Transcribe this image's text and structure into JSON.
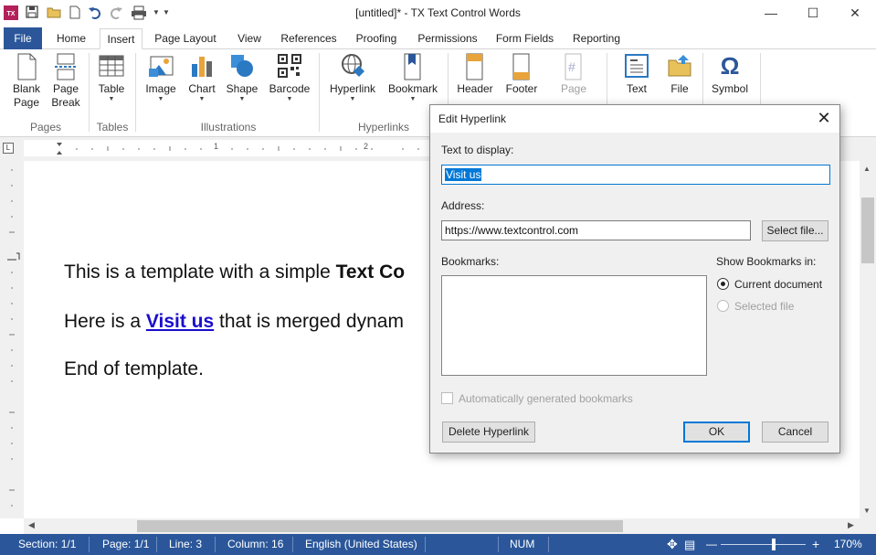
{
  "window": {
    "title": "[untitled]* - TX Text Control Words",
    "app_icon": "TX",
    "minimize_label": "—",
    "maximize_label": "☐",
    "close_label": "✕"
  },
  "quick_access": {
    "icons": [
      "save-icon",
      "open-folder-icon",
      "new-document-icon",
      "undo-icon",
      "redo-icon",
      "print-icon",
      "customize-dropdown-icon"
    ]
  },
  "tabs": [
    {
      "label": "File"
    },
    {
      "label": "Home"
    },
    {
      "label": "Insert"
    },
    {
      "label": "Page Layout"
    },
    {
      "label": "View"
    },
    {
      "label": "References"
    },
    {
      "label": "Proofing"
    },
    {
      "label": "Permissions"
    },
    {
      "label": "Form Fields"
    },
    {
      "label": "Reporting"
    }
  ],
  "ribbon": {
    "buttons": {
      "blank_page": "Blank\nPage",
      "page_break": "Page\nBreak",
      "table": "Table",
      "image": "Image",
      "chart": "Chart",
      "shape": "Shape",
      "barcode": "Barcode",
      "hyperlink": "Hyperlink",
      "bookmark": "Bookmark",
      "header": "Header",
      "footer": "Footer",
      "page_number": "Page",
      "text": "Text",
      "file": "File",
      "symbol": "Symbol"
    },
    "groups": {
      "pages": "Pages",
      "tables": "Tables",
      "illustrations": "Illustrations",
      "hyperlinks": "Hyperlinks"
    },
    "symbol_glyph": "Ω",
    "page_number_glyph": "#"
  },
  "ruler": {
    "corner": "L",
    "marks": [
      "1",
      "2"
    ]
  },
  "document": {
    "line1_prefix": "This is a template with a simple ",
    "line1_bold": "Text Co",
    "line2_prefix": "Here is a ",
    "line2_link": "Visit us",
    "line2_suffix": " that is merged dynam",
    "line3": "End of template."
  },
  "statusbar": {
    "section": "Section: 1/1",
    "page": "Page: 1/1",
    "line": "Line: 3",
    "column": "Column: 16",
    "language": "English (United States)",
    "num": "NUM",
    "zoom": "170%",
    "zoom_level": 0.62
  },
  "dialog": {
    "title": "Edit Hyperlink",
    "text_to_display_label": "Text to display:",
    "text_to_display_value": "Visit us",
    "address_label": "Address:",
    "address_value": "https://www.textcontrol.com",
    "select_file_button": "Select file...",
    "bookmarks_label": "Bookmarks:",
    "show_bookmarks_label": "Show Bookmarks in:",
    "current_document_option": "Current document",
    "selected_file_option": "Selected file",
    "auto_bookmarks_label": "Automatically generated bookmarks",
    "delete_button": "Delete Hyperlink",
    "ok_button": "OK",
    "cancel_button": "Cancel",
    "close_label": "✕"
  }
}
